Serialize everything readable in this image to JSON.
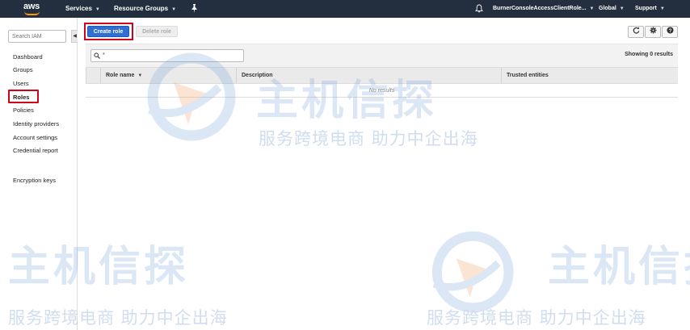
{
  "topbar": {
    "logo_text": "aws",
    "services": "Services",
    "resource_groups": "Resource Groups",
    "account": "BurnerConsoleAccessClientRole...",
    "region": "Global",
    "support": "Support"
  },
  "sidebar": {
    "search_placeholder": "Search IAM",
    "items": [
      {
        "label": "Dashboard"
      },
      {
        "label": "Groups"
      },
      {
        "label": "Users"
      },
      {
        "label": "Roles"
      },
      {
        "label": "Policies"
      },
      {
        "label": "Identity providers"
      },
      {
        "label": "Account settings"
      },
      {
        "label": "Credential report"
      },
      {
        "label": "Encryption keys"
      }
    ],
    "active": "Roles"
  },
  "toolbar": {
    "create_role": "Create role",
    "delete_role": "Delete role",
    "icons": [
      "refresh-icon",
      "gear-icon",
      "help-icon"
    ],
    "help_glyph": "?"
  },
  "table": {
    "filter_value": "*",
    "showing": "Showing 0 results",
    "columns": [
      "Role name",
      "Description",
      "Trusted entities"
    ],
    "empty_text": "No results"
  },
  "watermark": {
    "title": "主机信探",
    "tagline": "服务跨境电商 助力中企出海"
  },
  "colors": {
    "topbar": "#232f3e",
    "primary": "#2f6fd1",
    "highlight": "#d0021b",
    "aws_orange": "#ff9900"
  }
}
